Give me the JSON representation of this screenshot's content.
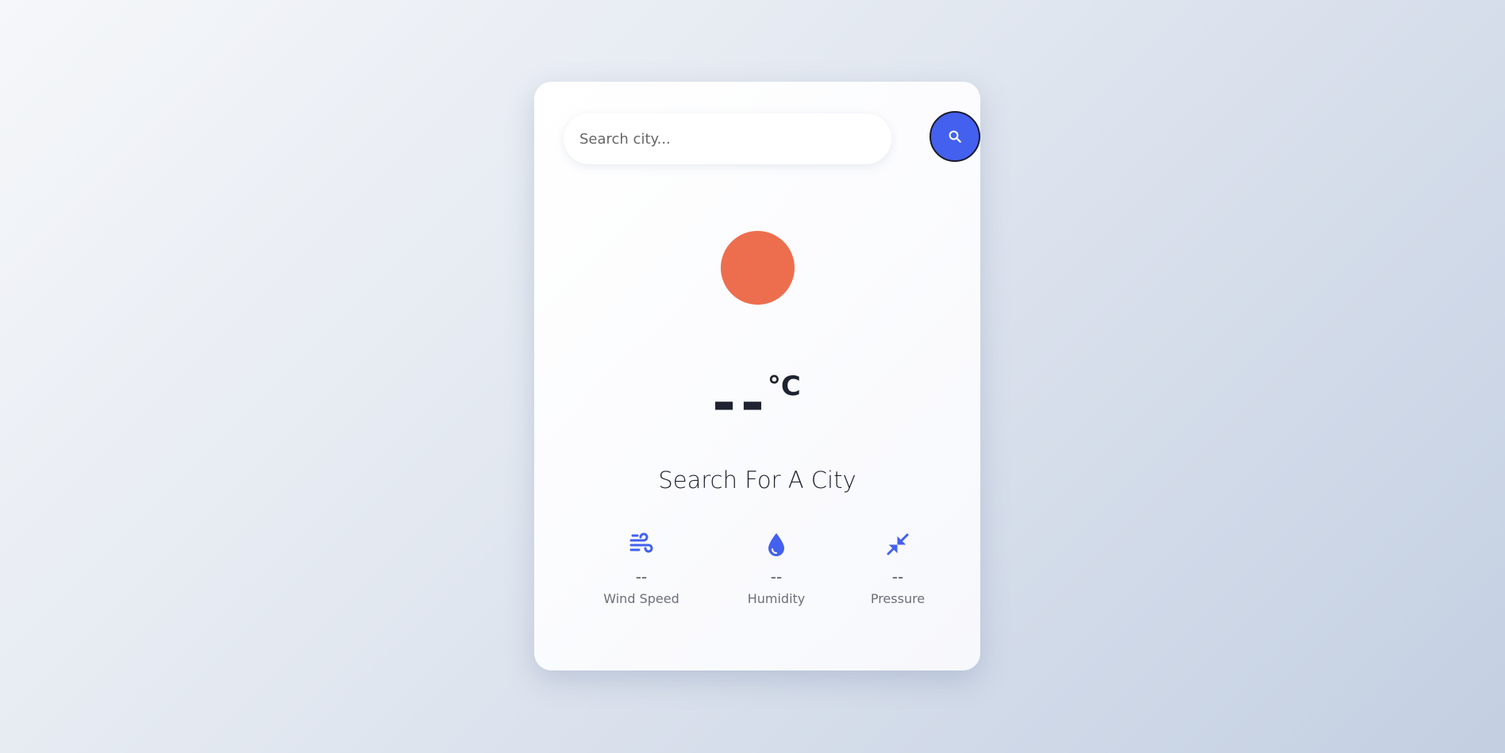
{
  "search": {
    "placeholder": "Search city...",
    "value": "",
    "button_icon": "search-icon"
  },
  "weather": {
    "icon": "sun-icon",
    "icon_color": "#ed6e4e",
    "temperature": "--",
    "unit": "°C",
    "city": "Search For A City"
  },
  "stats": [
    {
      "icon": "wind-icon",
      "value": "--",
      "label": "Wind Speed"
    },
    {
      "icon": "droplet-icon",
      "value": "--",
      "label": "Humidity"
    },
    {
      "icon": "compress-icon",
      "value": "--",
      "label": "Pressure"
    }
  ],
  "colors": {
    "accent": "#4361ee",
    "text": "#1f2230",
    "muted": "#6b6f7a"
  }
}
